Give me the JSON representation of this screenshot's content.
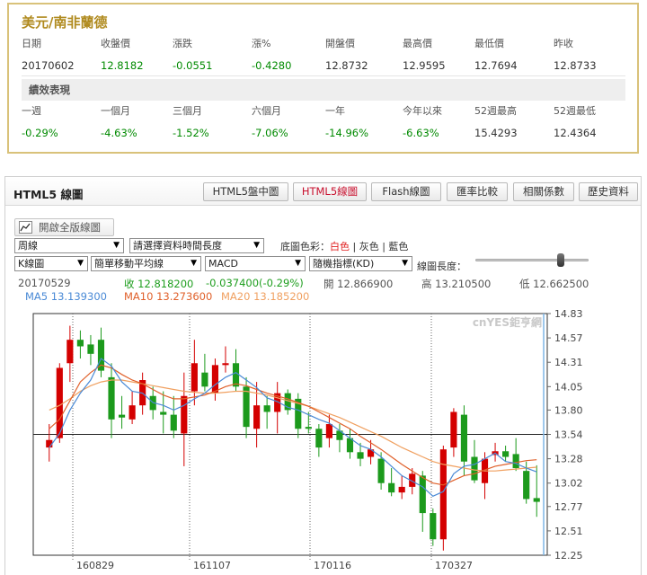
{
  "quote": {
    "title": "美元/南非蘭德",
    "headers": [
      "日期",
      "收盤價",
      "漲跌",
      "漲%",
      "開盤價",
      "最高價",
      "最低價",
      "昨收"
    ],
    "values": [
      "20170602",
      "12.8182",
      "-0.0551",
      "-0.4280",
      "12.8732",
      "12.9595",
      "12.7694",
      "12.8733"
    ],
    "perf_title": "績效表現",
    "perf_headers": [
      "一週",
      "一個月",
      "三個月",
      "六個月",
      "一年",
      "今年以來",
      "52週最高",
      "52週最低"
    ],
    "perf_values": [
      "-0.29%",
      "-4.63%",
      "-1.52%",
      "-7.06%",
      "-14.96%",
      "-6.63%",
      "15.4293",
      "12.4364"
    ]
  },
  "chart_panel": {
    "title": "HTML5 線圖",
    "tabs": [
      "HTML5盤中圖",
      "HTML5線圖",
      "Flash線圖",
      "匯率比較",
      "相關係數",
      "歷史資料"
    ],
    "active_tab": "HTML5線圖",
    "full_button": "開啟全版線圖",
    "selects": {
      "period": "周線",
      "range": "請選擇資料時間長度",
      "type": "K線圖",
      "ma": "簡單移動平均線",
      "indicator1": "MACD",
      "indicator2": "隨機指標(KD)"
    },
    "bg_color_label": "底圖色彩：",
    "bg_color_options": [
      "白色",
      "灰色",
      "藍色"
    ],
    "bg_color_selected": "白色",
    "size_label": "線圖長度：",
    "size_level": 0.75,
    "info": {
      "date": "20170529",
      "close": "收 12.818200",
      "change": "-0.037400(-0.29%)",
      "open": "開 12.866900",
      "high": "高 13.210500",
      "low": "低 12.662500",
      "ma5": "MA5 13.139300",
      "ma10": "MA10 13.273600",
      "ma20": "MA20 13.185200"
    },
    "watermark": "cnYES鉅亨網",
    "colors": {
      "up": "#d40000",
      "down": "#1c9a1c",
      "ma5": "#4a8ad6",
      "ma10": "#e0602a",
      "ma20": "#f0a060",
      "accent": "#c8102e"
    }
  },
  "chart_data": {
    "type": "candlestick",
    "y_ticks": [
      "14.83",
      "14.57",
      "14.31",
      "14.05",
      "13.80",
      "13.54",
      "13.28",
      "13.02",
      "12.77",
      "12.51",
      "12.25"
    ],
    "x_ticks": [
      "160829",
      "161107",
      "170116",
      "170327"
    ],
    "ylim": [
      12.25,
      14.83
    ],
    "reference_line": 13.54,
    "candles": [
      {
        "o": 13.4,
        "h": 13.65,
        "l": 13.25,
        "c": 13.48
      },
      {
        "o": 13.5,
        "h": 14.3,
        "l": 13.45,
        "c": 14.25
      },
      {
        "o": 14.3,
        "h": 14.7,
        "l": 14.1,
        "c": 14.55
      },
      {
        "o": 14.55,
        "h": 14.65,
        "l": 14.35,
        "c": 14.48
      },
      {
        "o": 14.5,
        "h": 14.6,
        "l": 14.28,
        "c": 14.4
      },
      {
        "o": 14.55,
        "h": 14.68,
        "l": 14.15,
        "c": 14.22
      },
      {
        "o": 14.15,
        "h": 14.3,
        "l": 13.5,
        "c": 13.7
      },
      {
        "o": 13.75,
        "h": 13.95,
        "l": 13.6,
        "c": 13.72
      },
      {
        "o": 13.7,
        "h": 14.0,
        "l": 13.65,
        "c": 13.85
      },
      {
        "o": 13.85,
        "h": 14.2,
        "l": 13.75,
        "c": 14.12
      },
      {
        "o": 13.95,
        "h": 14.05,
        "l": 13.7,
        "c": 13.8
      },
      {
        "o": 13.78,
        "h": 14.0,
        "l": 13.55,
        "c": 13.75
      },
      {
        "o": 13.75,
        "h": 13.95,
        "l": 13.5,
        "c": 13.58
      },
      {
        "o": 13.55,
        "h": 14.2,
        "l": 13.2,
        "c": 13.95
      },
      {
        "o": 14.0,
        "h": 14.55,
        "l": 13.85,
        "c": 14.3
      },
      {
        "o": 14.2,
        "h": 14.4,
        "l": 14.0,
        "c": 14.05
      },
      {
        "o": 13.98,
        "h": 14.35,
        "l": 13.9,
        "c": 14.28
      },
      {
        "o": 14.28,
        "h": 14.48,
        "l": 14.2,
        "c": 14.3
      },
      {
        "o": 14.3,
        "h": 14.45,
        "l": 14.0,
        "c": 14.05
      },
      {
        "o": 14.05,
        "h": 14.15,
        "l": 13.5,
        "c": 13.62
      },
      {
        "o": 13.6,
        "h": 14.1,
        "l": 13.4,
        "c": 13.85
      },
      {
        "o": 13.85,
        "h": 13.95,
        "l": 13.6,
        "c": 13.78
      },
      {
        "o": 13.78,
        "h": 14.1,
        "l": 13.55,
        "c": 13.98
      },
      {
        "o": 13.98,
        "h": 14.02,
        "l": 13.75,
        "c": 13.8
      },
      {
        "o": 13.92,
        "h": 13.98,
        "l": 13.5,
        "c": 13.6
      },
      {
        "o": 13.62,
        "h": 13.78,
        "l": 13.55,
        "c": 13.6
      },
      {
        "o": 13.6,
        "h": 13.65,
        "l": 13.3,
        "c": 13.4
      },
      {
        "o": 13.5,
        "h": 13.75,
        "l": 13.4,
        "c": 13.65
      },
      {
        "o": 13.58,
        "h": 13.65,
        "l": 13.35,
        "c": 13.48
      },
      {
        "o": 13.5,
        "h": 13.6,
        "l": 13.28,
        "c": 13.35
      },
      {
        "o": 13.35,
        "h": 13.45,
        "l": 13.2,
        "c": 13.28
      },
      {
        "o": 13.3,
        "h": 13.48,
        "l": 13.22,
        "c": 13.38
      },
      {
        "o": 13.28,
        "h": 13.35,
        "l": 12.95,
        "c": 13.02
      },
      {
        "o": 13.02,
        "h": 13.18,
        "l": 12.88,
        "c": 12.92
      },
      {
        "o": 12.92,
        "h": 13.1,
        "l": 12.85,
        "c": 12.98
      },
      {
        "o": 12.98,
        "h": 13.18,
        "l": 12.9,
        "c": 13.12
      },
      {
        "o": 13.1,
        "h": 13.15,
        "l": 12.5,
        "c": 12.7
      },
      {
        "o": 12.7,
        "h": 12.75,
        "l": 12.35,
        "c": 12.42
      },
      {
        "o": 12.42,
        "h": 13.42,
        "l": 12.3,
        "c": 13.38
      },
      {
        "o": 13.4,
        "h": 13.82,
        "l": 13.3,
        "c": 13.78
      },
      {
        "o": 13.75,
        "h": 13.85,
        "l": 13.1,
        "c": 13.25
      },
      {
        "o": 13.3,
        "h": 13.48,
        "l": 13.02,
        "c": 13.05
      },
      {
        "o": 13.02,
        "h": 13.35,
        "l": 12.85,
        "c": 13.28
      },
      {
        "o": 13.32,
        "h": 13.45,
        "l": 13.25,
        "c": 13.36
      },
      {
        "o": 13.36,
        "h": 13.42,
        "l": 13.25,
        "c": 13.3
      },
      {
        "o": 13.33,
        "h": 13.5,
        "l": 13.15,
        "c": 13.18
      },
      {
        "o": 13.15,
        "h": 13.25,
        "l": 12.8,
        "c": 12.85
      },
      {
        "o": 12.86,
        "h": 13.21,
        "l": 12.66,
        "c": 12.82
      }
    ],
    "ma5": [
      13.4,
      13.55,
      13.8,
      13.98,
      14.12,
      14.35,
      14.27,
      14.1,
      14.0,
      13.98,
      13.88,
      13.85,
      13.8,
      13.85,
      13.92,
      13.98,
      14.07,
      14.15,
      14.2,
      14.12,
      14.04,
      13.93,
      13.89,
      13.83,
      13.8,
      13.75,
      13.7,
      13.66,
      13.58,
      13.5,
      13.42,
      13.38,
      13.3,
      13.2,
      13.1,
      13.04,
      12.98,
      12.88,
      12.93,
      13.12,
      13.2,
      13.22,
      13.28,
      13.34,
      13.25,
      13.23,
      13.18,
      13.14
    ],
    "ma10": [
      13.6,
      13.7,
      13.9,
      14.1,
      14.2,
      14.28,
      14.25,
      14.18,
      14.12,
      14.08,
      14.02,
      13.96,
      13.92,
      13.92,
      13.94,
      13.96,
      14.0,
      14.05,
      14.08,
      14.06,
      14.02,
      13.98,
      13.95,
      13.92,
      13.88,
      13.84,
      13.78,
      13.72,
      13.66,
      13.6,
      13.52,
      13.45,
      13.38,
      13.3,
      13.22,
      13.15,
      13.08,
      13.02,
      13.0,
      13.05,
      13.1,
      13.12,
      13.16,
      13.2,
      13.22,
      13.24,
      13.26,
      13.27
    ],
    "ma20": [
      13.8,
      13.85,
      13.92,
      14.0,
      14.06,
      14.1,
      14.12,
      14.12,
      14.1,
      14.08,
      14.06,
      14.04,
      14.02,
      14.0,
      13.99,
      13.98,
      13.98,
      13.99,
      14.0,
      14.0,
      13.98,
      13.96,
      13.93,
      13.9,
      13.87,
      13.84,
      13.8,
      13.76,
      13.72,
      13.67,
      13.62,
      13.57,
      13.52,
      13.46,
      13.4,
      13.35,
      13.3,
      13.25,
      13.22,
      13.2,
      13.18,
      13.16,
      13.15,
      13.15,
      13.16,
      13.17,
      13.18,
      13.19
    ]
  }
}
